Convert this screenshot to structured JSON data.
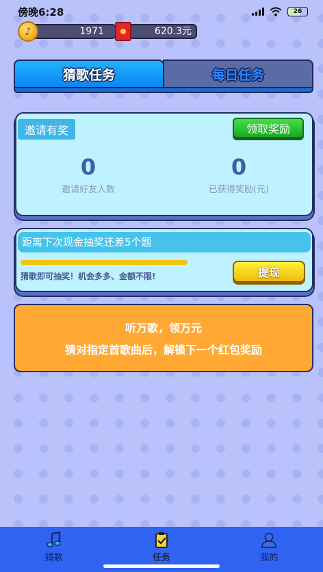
{
  "status_bar": {
    "time": "傍晚6:28",
    "battery": "26"
  },
  "wallet": {
    "coins": "1971",
    "cash": "620.3元"
  },
  "tabs": [
    {
      "label": "猜歌任务",
      "active": true
    },
    {
      "label": "每日任务",
      "active": false
    }
  ],
  "invite": {
    "title": "邀请有奖",
    "claim_button": "领取奖励",
    "friends_count": "0",
    "friends_label": "邀请好友人数",
    "reward_count": "0",
    "reward_label": "已获得奖励(元)"
  },
  "draw": {
    "header": "距离下次现金抽奖还差5个题",
    "progress": 1.0,
    "description": "猜歌即可抽奖！机会多多、金额不限!",
    "withdraw_button": "提现"
  },
  "promo": {
    "line1": "听万歌，领万元",
    "line2": "猜对指定首歌曲后，解锁下一个红包奖励"
  },
  "bottom_nav": [
    {
      "label": "猜歌",
      "icon": "music-note-icon",
      "active": false
    },
    {
      "label": "任务",
      "icon": "clipboard-check-icon",
      "active": true
    },
    {
      "label": "我的",
      "icon": "person-icon",
      "active": false
    }
  ],
  "colors": {
    "background": "#b9c2fb",
    "tab_active": "#0b87f2",
    "claim_green": "#17a922",
    "withdraw_yellow": "#f2ba0c",
    "promo_orange": "#ffa834",
    "nav_blue": "#2f63f2"
  }
}
